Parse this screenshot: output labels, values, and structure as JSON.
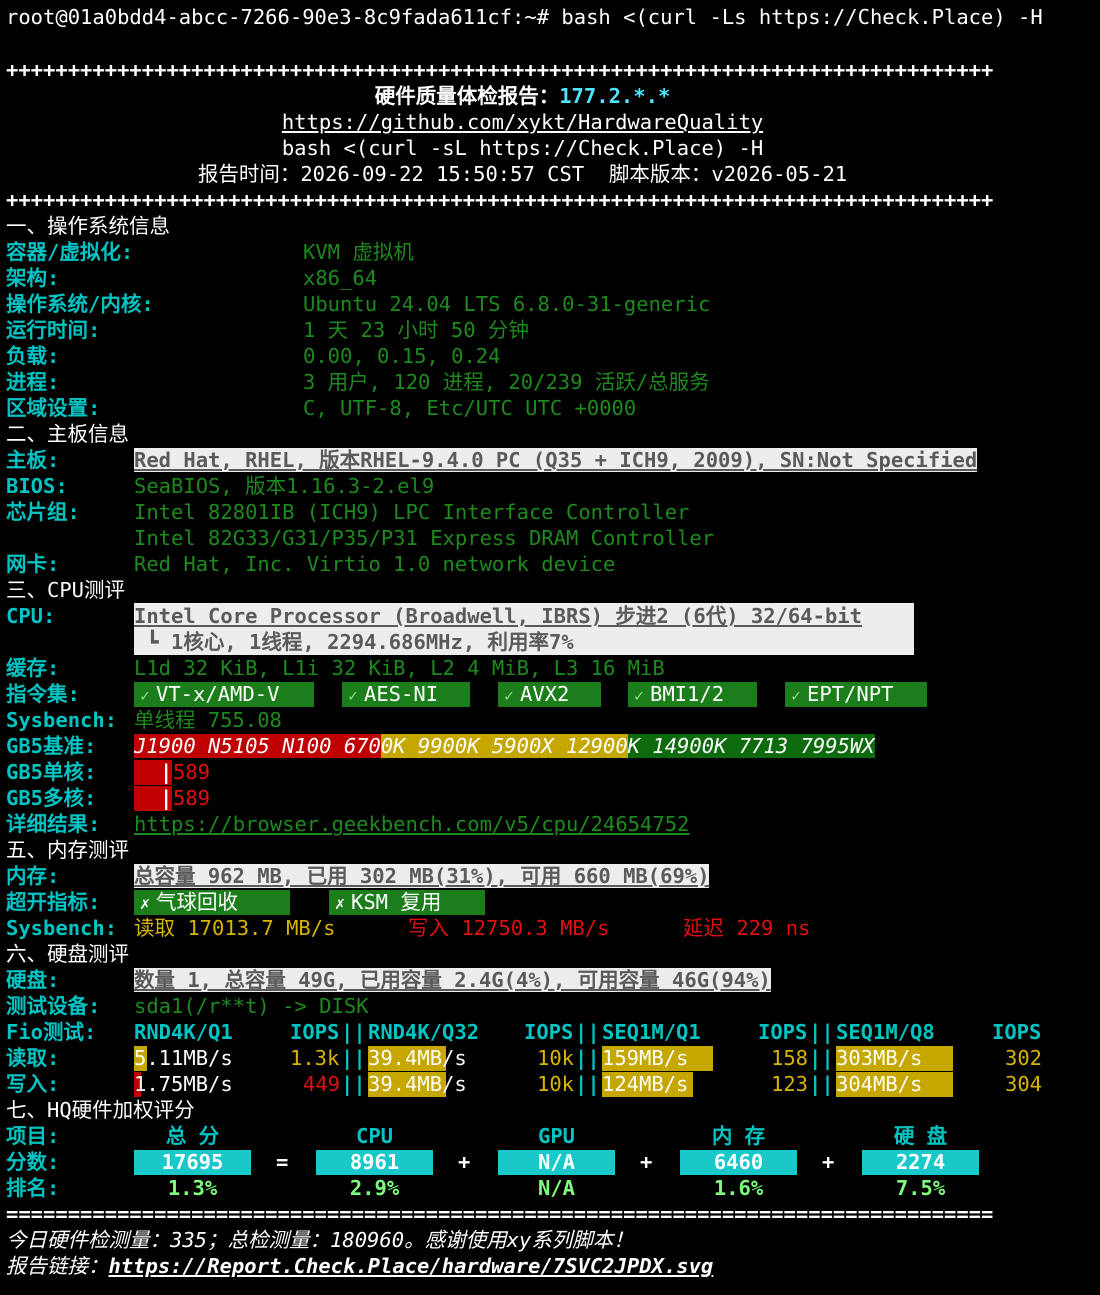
{
  "prompt": "root@01a0bdd4-abcc-7266-90e3-8c9fada611cf:~# bash <(curl -Ls https://Check.Place) -H",
  "separator_plus": "++++++++++++++++++++++++++++++++++++++++++++++++++++++++++++++++++++++++++++++++",
  "separator_eq": "================================================================================",
  "header": {
    "title": "硬件质量体检报告：",
    "ip": "177.2.*.*",
    "repo_url": "https://github.com/xykt/HardwareQuality",
    "command": "bash <(curl -sL https://Check.Place) -H",
    "report_time": "报告时间：2026-09-22 15:50:57 CST  脚本版本：v2026-05-21"
  },
  "os": {
    "heading": "一、操作系统信息",
    "rows": [
      {
        "label": "容器/虚拟化:",
        "value": "KVM 虚拟机"
      },
      {
        "label": "架构:",
        "value": "x86_64"
      },
      {
        "label": "操作系统/内核:",
        "value": "Ubuntu 24.04 LTS 6.8.0-31-generic"
      },
      {
        "label": "运行时间:",
        "value": "1 天 23 小时 50 分钟"
      },
      {
        "label": "负载:",
        "value": "0.00, 0.15, 0.24"
      },
      {
        "label": "进程:",
        "value": "3 用户, 120 进程, 20/239 活跃/总服务"
      },
      {
        "label": "区域设置:",
        "value": "C, UTF-8, Etc/UTC UTC +0000"
      }
    ]
  },
  "board": {
    "heading": "二、主板信息",
    "mainboard_label": "主板:",
    "mainboard_value": "Red Hat, RHEL, 版本RHEL-9.4.0 PC (Q35 + ICH9, 2009), SN:Not Specified",
    "bios_label": "BIOS:",
    "bios_value": "SeaBIOS, 版本1.16.3-2.el9",
    "chipset_label": "芯片组:",
    "chipset_value_1": "Intel 82801IB (ICH9) LPC Interface Controller",
    "chipset_value_2": "Intel 82G33/G31/P35/P31 Express DRAM Controller",
    "nic_label": "网卡:",
    "nic_value": "Red Hat, Inc. Virtio 1.0 network device"
  },
  "cpu": {
    "heading": "三、CPU测评",
    "cpu_label": "CPU:",
    "cpu_value": "Intel Core Processor (Broadwell, IBRS) 步进2 (6代) 32/64-bit",
    "cpu_sub": " ┗ 1核心, 1线程, 2294.686MHz, 利用率7%",
    "cache_label": "缓存:",
    "cache_value": "L1d 32 KiB, L1i 32 KiB, L2 4 MiB, L3 16 MiB",
    "isa_label": "指令集:",
    "isa": [
      "VT-x/AMD-V",
      "AES-NI",
      "AVX2",
      "BMI1/2",
      "EPT/NPT"
    ],
    "sysbench_label": "Sysbench:",
    "sysbench_value": "单线程 755.08",
    "gb5_ref_label": "GB5基准:",
    "gb5_ref_red": "J1900 N5105 N100 670",
    "gb5_ref_yellow": "0K 9900K 5900X 12900",
    "gb5_ref_green": "K 14900K 7713 7995WX",
    "gb5_single_label": "GB5单核:",
    "gb5_single_value": "589",
    "gb5_multi_label": "GB5多核:",
    "gb5_multi_value": "589",
    "detail_label": "详细结果:",
    "detail_url": "https://browser.geekbench.com/v5/cpu/24654752"
  },
  "memory": {
    "heading": "五、内存测评",
    "mem_label": "内存:",
    "mem_value": "总容量 962 MB, 已用 302 MB(31%), 可用 660 MB(69%)",
    "ext_label": "超开指标:",
    "ext": [
      "气球回收",
      "KSM 复用"
    ],
    "sysbench_label": "Sysbench:",
    "read_label": "读取",
    "read_value": "17013.7 MB/s",
    "write_label": "写入",
    "write_value": "12750.3 MB/s",
    "latency_label": "延迟",
    "latency_value": "229 ns"
  },
  "disk": {
    "heading": "六、硬盘测评",
    "disk_label": "硬盘:",
    "disk_value": "数量 1, 总容量 49G, 已用容量 2.4G(4%), 可用容量 46G(94%)",
    "device_label": "测试设备:",
    "device_value": "sda1(/r**t) -> DISK",
    "fio_label": "Fio测试:",
    "fio_cols": [
      "RND4K/Q1",
      "RND4K/Q32",
      "SEQ1M/Q1",
      "SEQ1M/Q8"
    ],
    "iops_label": "IOPS",
    "read_label": "读取:",
    "write_label": "写入:",
    "read_values": [
      "5.11MB/s",
      "39.4MB/s",
      "159MB/s",
      "303MB/s"
    ],
    "read_iops": [
      "1.3k",
      "10k",
      "158",
      "302"
    ],
    "write_values": [
      "1.75MB/s",
      "39.4MB/s",
      "124MB/s",
      "304MB/s"
    ],
    "write_iops": [
      "449",
      "10k",
      "123",
      "304"
    ]
  },
  "score": {
    "heading": "七、HQ硬件加权评分",
    "item_label": "项目:",
    "score_label": "分数:",
    "rank_label": "排名:",
    "items": [
      "总 分",
      "CPU",
      "GPU",
      "内 存",
      "硬 盘"
    ],
    "scores": [
      "17695",
      "8961",
      "N/A",
      "6460",
      "2274"
    ],
    "ranks": [
      "1.3%",
      "2.9%",
      "N/A",
      "1.6%",
      "7.5%"
    ],
    "ops": [
      "=",
      "+",
      "+",
      "+"
    ]
  },
  "footer": {
    "stats": "今日硬件检测量：335；总检测量：180960。感谢使用xy系列脚本！",
    "report_label": "报告链接：",
    "report_url": "https://Report.Check.Place/hardware/7SVC2JPDX.svg"
  },
  "colors": {
    "background": "#000000",
    "label_cyan": "#00c3c3",
    "value_green": "#1e8a1e",
    "ip_cyan": "#4ee6ff",
    "bar_red": "#c00000",
    "bar_yellow": "#c6a700",
    "bar_green": "#0d6b0d",
    "score_box": "#19c8c8"
  },
  "fio_fill": {
    "read": [
      0.1,
      0.6,
      0.85,
      0.9
    ],
    "write": [
      0.05,
      0.6,
      0.7,
      0.9
    ]
  }
}
